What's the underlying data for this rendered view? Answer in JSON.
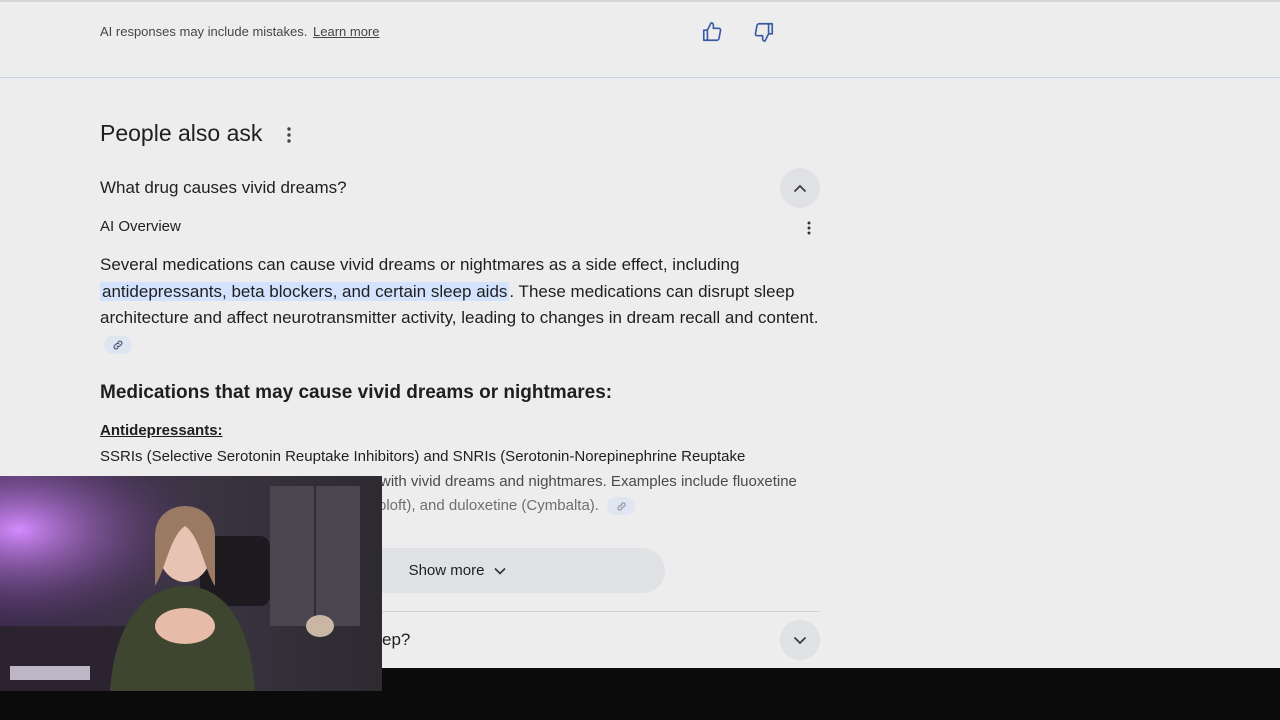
{
  "header": {
    "disclaimer": "AI responses may include mistakes.",
    "learn_more": "Learn more"
  },
  "paa": {
    "title": "People also ask",
    "questions": [
      {
        "text": "What drug causes vivid dreams?",
        "expanded": true
      },
      {
        "text": "ep?",
        "expanded": false
      }
    ]
  },
  "overview": {
    "label": "AI Overview",
    "para_before": "Several medications can cause vivid dreams or nightmares as a side effect, including ",
    "para_highlight": "antidepressants, beta blockers, and certain sleep aids",
    "para_after": ". These medications can disrupt sleep architecture and affect neurotransmitter activity, leading to changes in dream recall and content.",
    "heading": "Medications that may cause vivid dreams or nightmares:",
    "subheading": "Antidepressants:",
    "sub_line1": "SSRIs (Selective Serotonin Reuptake Inhibitors) and SNRIs (Serotonin-Norepinephrine Reuptake",
    "sub_line2": "with vivid dreams and nightmares. Examples include fluoxetine",
    "sub_line3": "oloft), and duloxetine (Cymbalta).",
    "show_more": "Show more"
  },
  "colors": {
    "background": "#ededed",
    "highlight": "#d3e3fd",
    "chip": "#dfe1e4",
    "bottom_bar": "#0b0b0b"
  },
  "icons": [
    "thumbs-up-icon",
    "thumbs-down-icon",
    "more-vert-icon",
    "chevron-up-icon",
    "chevron-down-icon",
    "link-icon"
  ]
}
